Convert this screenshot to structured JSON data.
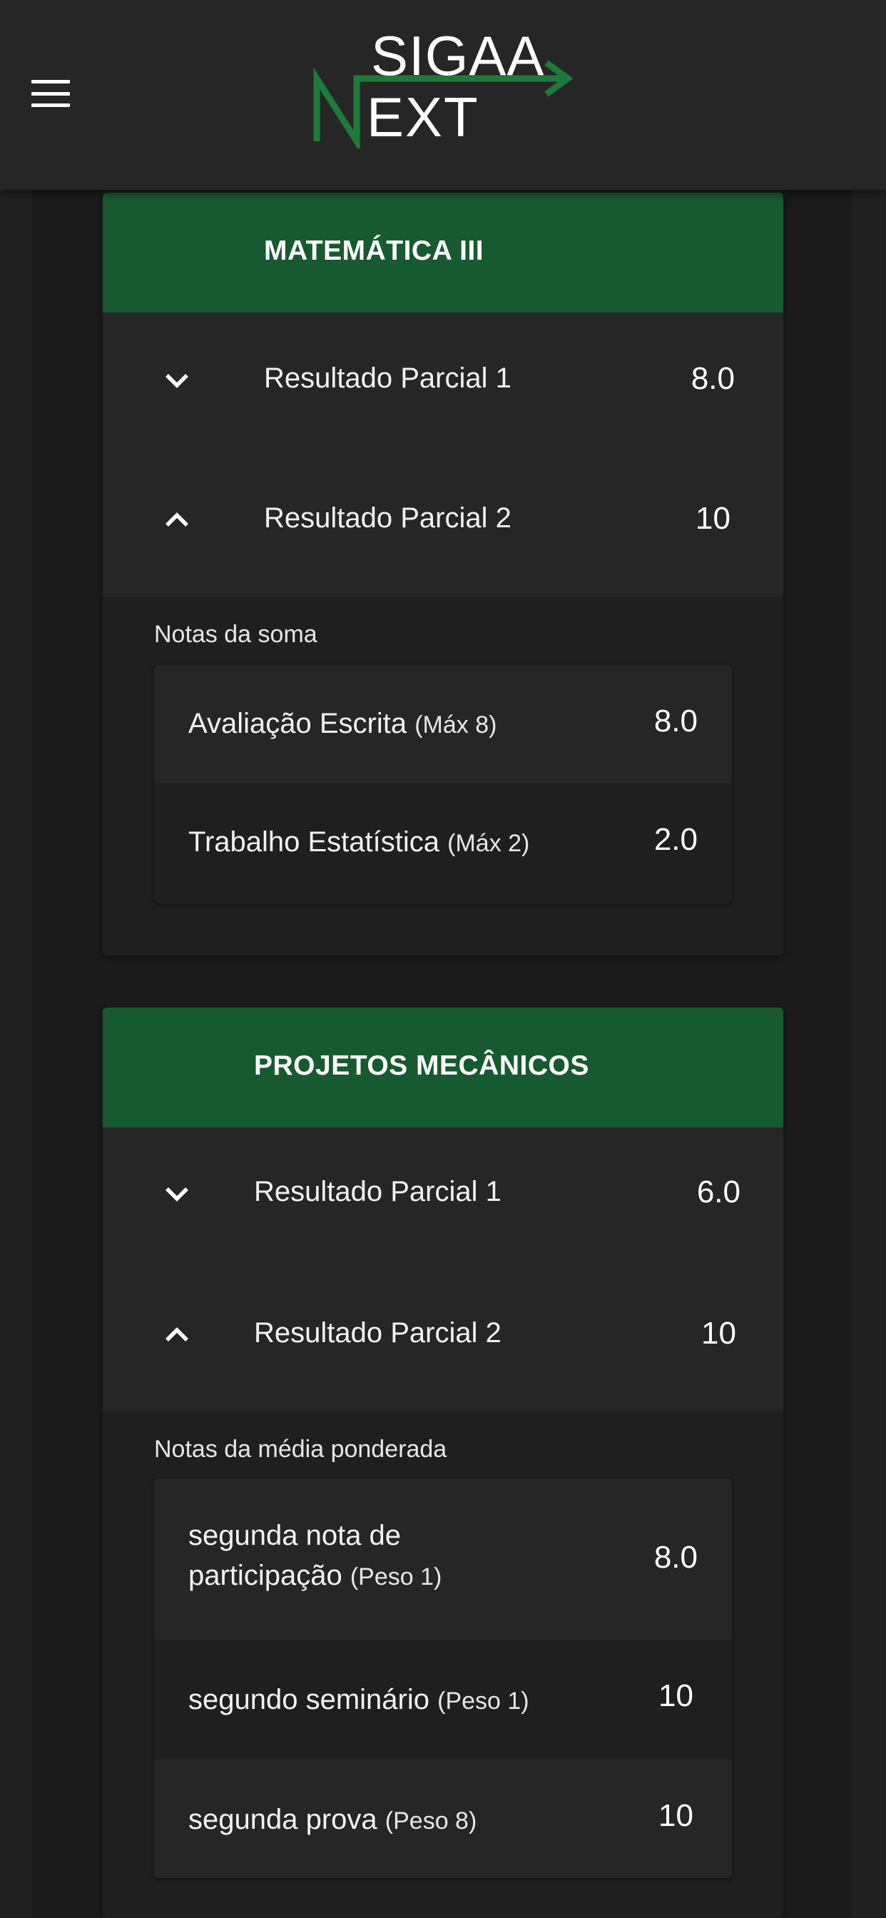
{
  "app": {
    "logo_top": "SIGAA",
    "logo_bottom": "EXT",
    "logo_letter": "N",
    "accent_color": "#1f7a3a",
    "header_color": "#185a2f",
    "menu_icon": "hamburger-menu-icon"
  },
  "subjects": [
    {
      "title": "MATEMÁTICA III",
      "results": [
        {
          "label": "Resultado Parcial 1",
          "value": "8.0",
          "icon": "chevron-down-icon"
        },
        {
          "label": "Resultado Parcial 2",
          "value": "10",
          "icon": "chevron-up-icon"
        }
      ],
      "notes_label": "Notas da soma",
      "notes": [
        {
          "name": "Avaliação Escrita",
          "detail": "(Máx 8)",
          "value": "8.0"
        },
        {
          "name": "Trabalho Estatística",
          "detail": "(Máx 2)",
          "value": "2.0"
        }
      ]
    },
    {
      "title": "PROJETOS MECÂNICOS",
      "results": [
        {
          "label": "Resultado Parcial 1",
          "value": "6.0",
          "icon": "chevron-down-icon"
        },
        {
          "label": "Resultado Parcial 2",
          "value": "10",
          "icon": "chevron-up-icon"
        }
      ],
      "notes_label": "Notas da média ponderada",
      "notes": [
        {
          "name_line1": "segunda nota de",
          "name_line2": "participação",
          "detail": "(Peso 1)",
          "value": "8.0"
        },
        {
          "name": "segundo seminário",
          "detail": "(Peso 1)",
          "value": "10"
        },
        {
          "name": "segunda prova",
          "detail": "(Peso 8)",
          "value": "10"
        }
      ]
    }
  ]
}
